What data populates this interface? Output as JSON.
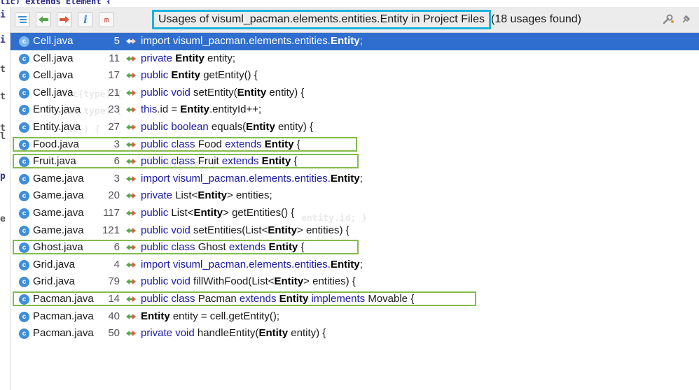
{
  "header": {
    "title": "Usages of visuml_pacman.elements.entities.Entity in Project Files",
    "count": "(18 usages found)",
    "merge_label": "m",
    "info_label": "i",
    "highlight_color": "#1fb2dc"
  },
  "editor": {
    "top_text": "lic) extends Element {",
    "gutter": [
      "i",
      "i",
      "t",
      "t",
      "t",
      "l",
      "",
      "p",
      "",
      "e"
    ],
    "ghost_lines": [
      "lic(type) {",
      "lic(type) {",
      "lic() {",
      "this.id; }",
      "entity.id; }"
    ]
  },
  "colors": {
    "selection": "#2f6ecf",
    "class_icon": "#3f8ed6",
    "keyword": "#1a1aa6",
    "green_box": "#84bb4c"
  },
  "rows": [
    {
      "file": "Cell.java",
      "line": "5",
      "code": [
        {
          "t": "import visuml_pacman.elements.entities.",
          "s": "kw"
        },
        {
          "t": "Entity",
          "s": "b"
        },
        {
          "t": ";",
          "s": "kw"
        }
      ]
    },
    {
      "file": "Cell.java",
      "line": "11",
      "code": [
        {
          "t": "private ",
          "s": "kw"
        },
        {
          "t": "Entity",
          "s": "b"
        },
        {
          "t": " entity;",
          "s": ""
        }
      ]
    },
    {
      "file": "Cell.java",
      "line": "17",
      "code": [
        {
          "t": "public ",
          "s": "kw"
        },
        {
          "t": "Entity",
          "s": "b"
        },
        {
          "t": " getEntity() {",
          "s": ""
        }
      ]
    },
    {
      "file": "Cell.java",
      "line": "21",
      "code": [
        {
          "t": "public void ",
          "s": "kw"
        },
        {
          "t": "setEntity(",
          "s": ""
        },
        {
          "t": "Entity",
          "s": "b"
        },
        {
          "t": " entity) {",
          "s": ""
        }
      ]
    },
    {
      "file": "Entity.java",
      "line": "23",
      "code": [
        {
          "t": "this",
          "s": "kw"
        },
        {
          "t": ".id = ",
          "s": ""
        },
        {
          "t": "Entity",
          "s": "b"
        },
        {
          "t": ".entityId++;",
          "s": ""
        }
      ]
    },
    {
      "file": "Entity.java",
      "line": "27",
      "code": [
        {
          "t": "public boolean ",
          "s": "kw"
        },
        {
          "t": "equals(",
          "s": ""
        },
        {
          "t": "Entity",
          "s": "b"
        },
        {
          "t": " entity) {",
          "s": ""
        }
      ]
    },
    {
      "file": "Food.java",
      "line": "3",
      "code": [
        {
          "t": "public class ",
          "s": "kw"
        },
        {
          "t": "Food ",
          "s": ""
        },
        {
          "t": "extends ",
          "s": "kw"
        },
        {
          "t": "Entity",
          "s": "b"
        },
        {
          "t": " {",
          "s": ""
        }
      ]
    },
    {
      "file": "Fruit.java",
      "line": "6",
      "code": [
        {
          "t": "public class ",
          "s": "kw"
        },
        {
          "t": "Fruit ",
          "s": ""
        },
        {
          "t": "extends ",
          "s": "kw"
        },
        {
          "t": "Entity",
          "s": "b"
        },
        {
          "t": " {",
          "s": ""
        }
      ]
    },
    {
      "file": "Game.java",
      "line": "3",
      "code": [
        {
          "t": "import visuml_pacman.elements.entities.",
          "s": "kw"
        },
        {
          "t": "Entity",
          "s": "b"
        },
        {
          "t": ";",
          "s": ""
        }
      ]
    },
    {
      "file": "Game.java",
      "line": "20",
      "code": [
        {
          "t": "private ",
          "s": "kw"
        },
        {
          "t": "List<",
          "s": ""
        },
        {
          "t": "Entity",
          "s": "b"
        },
        {
          "t": "> entities;",
          "s": ""
        }
      ]
    },
    {
      "file": "Game.java",
      "line": "117",
      "code": [
        {
          "t": "public ",
          "s": "kw"
        },
        {
          "t": "List<",
          "s": ""
        },
        {
          "t": "Entity",
          "s": "b"
        },
        {
          "t": "> getEntities() {",
          "s": ""
        }
      ]
    },
    {
      "file": "Game.java",
      "line": "121",
      "code": [
        {
          "t": "public void ",
          "s": "kw"
        },
        {
          "t": "setEntities(List<",
          "s": ""
        },
        {
          "t": "Entity",
          "s": "b"
        },
        {
          "t": "> entities) {",
          "s": ""
        }
      ]
    },
    {
      "file": "Ghost.java",
      "line": "6",
      "code": [
        {
          "t": "public class ",
          "s": "kw"
        },
        {
          "t": "Ghost ",
          "s": ""
        },
        {
          "t": "extends ",
          "s": "kw"
        },
        {
          "t": "Entity",
          "s": "b"
        },
        {
          "t": " {",
          "s": ""
        }
      ]
    },
    {
      "file": "Grid.java",
      "line": "4",
      "code": [
        {
          "t": "import visuml_pacman.elements.entities.",
          "s": "kw"
        },
        {
          "t": "Entity",
          "s": "b"
        },
        {
          "t": ";",
          "s": ""
        }
      ]
    },
    {
      "file": "Grid.java",
      "line": "79",
      "code": [
        {
          "t": "public void ",
          "s": "kw"
        },
        {
          "t": "fillWithFood(List<",
          "s": ""
        },
        {
          "t": "Entity",
          "s": "b"
        },
        {
          "t": "> entities) {",
          "s": ""
        }
      ]
    },
    {
      "file": "Pacman.java",
      "line": "14",
      "code": [
        {
          "t": "public class ",
          "s": "kw"
        },
        {
          "t": "Pacman ",
          "s": ""
        },
        {
          "t": "extends ",
          "s": "kw"
        },
        {
          "t": "Entity",
          "s": "b"
        },
        {
          "t": " ",
          "s": ""
        },
        {
          "t": "implements ",
          "s": "kw"
        },
        {
          "t": "Movable {",
          "s": ""
        }
      ]
    },
    {
      "file": "Pacman.java",
      "line": "40",
      "code": [
        {
          "t": "Entity",
          "s": "b"
        },
        {
          "t": " entity = cell.getEntity();",
          "s": ""
        }
      ]
    },
    {
      "file": "Pacman.java",
      "line": "50",
      "code": [
        {
          "t": "private void ",
          "s": "kw"
        },
        {
          "t": "handleEntity(",
          "s": ""
        },
        {
          "t": "Entity",
          "s": "b"
        },
        {
          "t": " entity) {",
          "s": ""
        }
      ]
    }
  ]
}
